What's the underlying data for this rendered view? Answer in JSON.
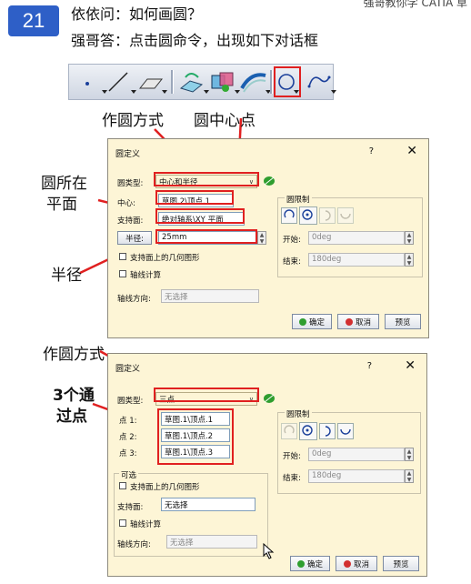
{
  "slide": {
    "number": "21",
    "question": "依依问：如何画圆？",
    "answer": "强哥答：点击圆命令，出现如下对话框",
    "top_right_partial": "强哥教你学 CATIA 草"
  },
  "toolbar": {
    "icons": [
      "point-icon",
      "line-icon",
      "plane-icon",
      "projection-icon",
      "intersection-icon",
      "parallel-curve-icon",
      "circle-icon",
      "spline-icon"
    ],
    "selected": "circle-icon"
  },
  "annotations": {
    "circle_type": "作圆方式",
    "circle_center": "圆中心点",
    "plane": "圆所在\n平面",
    "plane_l1": "圆所在",
    "plane_l2": "平面",
    "radius": "半径",
    "circle_type2": "作圆方式",
    "three_points_l1": "3个通",
    "three_points_l2": "过点"
  },
  "dialog1": {
    "title": "圆定义",
    "help": "?",
    "close": "✕",
    "type_label": "圆类型:",
    "type_value": "中心和半径",
    "center_label": "中心:",
    "center_value": "草图.2\\顶点.1",
    "support_label": "支持面:",
    "support_value": "绝对轴系\\XY 平面",
    "radius_label": "半径:",
    "radius_value": "25mm",
    "geom_support": "支持面上的几何图形",
    "axis_compute": "轴线计算",
    "axis_dir_label": "轴线方向:",
    "axis_dir_value": "无选择",
    "limit_group": "圆限制",
    "start_label": "开始:",
    "start_value": "0deg",
    "end_label": "结束:",
    "end_value": "180deg",
    "ok": "确定",
    "cancel": "取消",
    "preview": "预览"
  },
  "dialog2": {
    "title": "圆定义",
    "help": "?",
    "close": "✕",
    "type_label": "圆类型:",
    "type_value": "三点",
    "p1_label": "点 1:",
    "p1_value": "草图.1\\顶点.1",
    "p2_label": "点 2:",
    "p2_value": "草图.1\\顶点.2",
    "p3_label": "点 3:",
    "p3_value": "草图.1\\顶点.3",
    "optional": "可选",
    "geom_support": "支持面上的几何图形",
    "support_label": "支持面:",
    "support_value": "无选择",
    "axis_compute": "轴线计算",
    "axis_dir_label": "轴线方向:",
    "axis_dir_value": "无选择",
    "limit_group": "圆限制",
    "start_label": "开始:",
    "start_value": "0deg",
    "end_label": "结束:",
    "end_value": "180deg",
    "ok": "确定",
    "cancel": "取消",
    "preview": "预览"
  },
  "colors": {
    "slide_badge": "#2e5fc7",
    "highlight": "#e02020",
    "dialog_bg": "#fdf5d6"
  }
}
